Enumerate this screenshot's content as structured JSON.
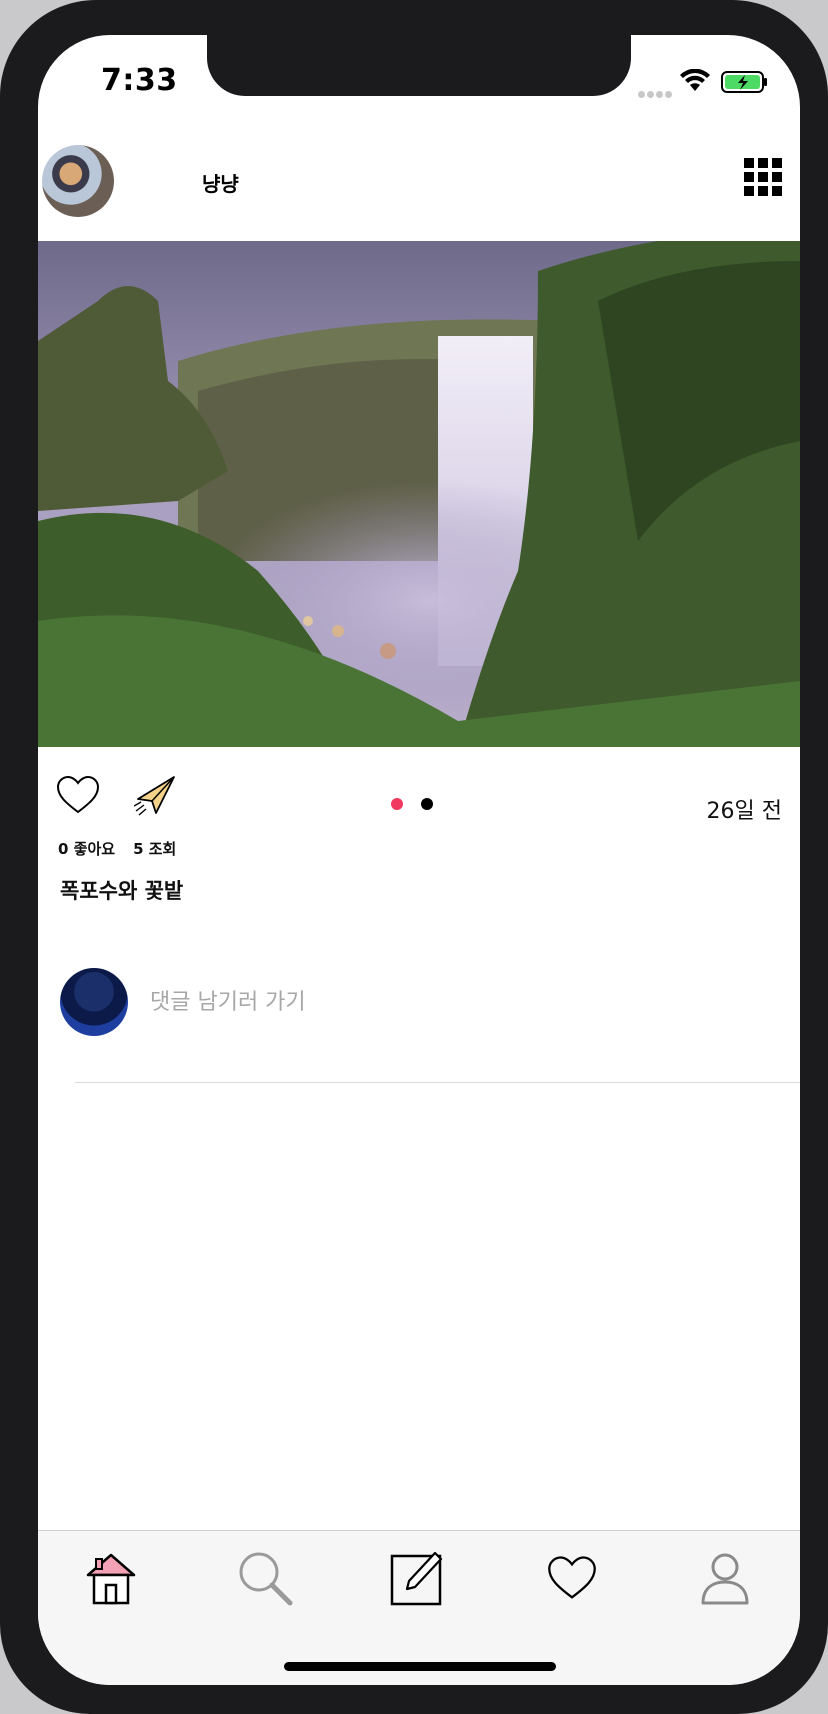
{
  "status_bar": {
    "time": "7:33"
  },
  "profile": {
    "username": "냥냥"
  },
  "post": {
    "time_ago": "26일 전",
    "likes_text": "0 좋아요",
    "views_text": "5 조회",
    "caption": "폭포수와 꽃밭",
    "page_indicator": {
      "total": 2,
      "current": 1
    }
  },
  "comment": {
    "placeholder": "댓글 남기러 가기"
  },
  "icons": {
    "grid": "grid-icon",
    "like": "heart-icon",
    "share": "paper-plane-icon",
    "tabs": [
      "home-icon",
      "search-icon",
      "compose-icon",
      "heart-icon",
      "profile-icon"
    ]
  },
  "colors": {
    "active_dot": "#f03a5f",
    "inactive_dot": "#000000",
    "battery": "#4cd964"
  }
}
